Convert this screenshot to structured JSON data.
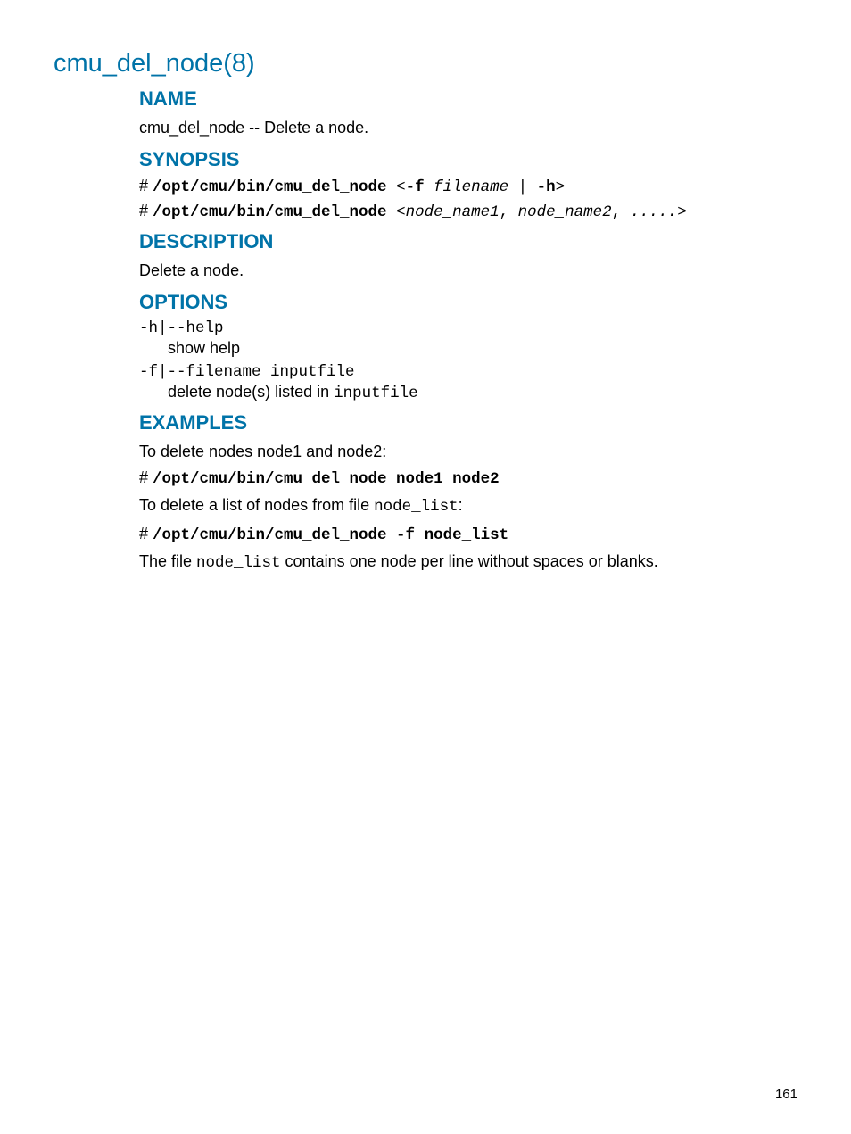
{
  "title": "cmu_del_node(8)",
  "sections": {
    "name": {
      "heading": "NAME",
      "text": "cmu_del_node -- Delete a node."
    },
    "synopsis": {
      "heading": "SYNOPSIS",
      "line1": {
        "hash": "# ",
        "cmd": "/opt/cmu/bin/cmu_del_node",
        "open": " <",
        "flag_f": "-f",
        "space": " ",
        "filename": "filename",
        "pipe": " | ",
        "flag_h": "-h",
        "close": ">"
      },
      "line2": {
        "hash": "# ",
        "cmd": "/opt/cmu/bin/cmu_del_node",
        "open": " <",
        "n1": "node_name1",
        "comma1": ", ",
        "n2": "node_name2",
        "comma2": ", ",
        "dots": ".....",
        "close": ">"
      }
    },
    "description": {
      "heading": "DESCRIPTION",
      "text": "Delete a node."
    },
    "options": {
      "heading": "OPTIONS",
      "opt1": {
        "dt": "-h|--help",
        "dd": "show help"
      },
      "opt2": {
        "dt": "-f|--filename inputfile",
        "dd_pre": "delete node(s) listed in ",
        "dd_code": "inputfile"
      }
    },
    "examples": {
      "heading": "EXAMPLES",
      "p1": "To delete nodes node1 and node2:",
      "c1_hash": "# ",
      "c1_cmd": "/opt/cmu/bin/cmu_del_node node1 node2",
      "p2_pre": "To delete a list of nodes from file ",
      "p2_code": "node_list",
      "p2_post": ":",
      "c2_hash": "# ",
      "c2_cmd": "/opt/cmu/bin/cmu_del_node -f node_list",
      "p3_pre": "The file ",
      "p3_code": "node_list",
      "p3_post": " contains one node per line without spaces or blanks."
    }
  },
  "page_number": "161"
}
